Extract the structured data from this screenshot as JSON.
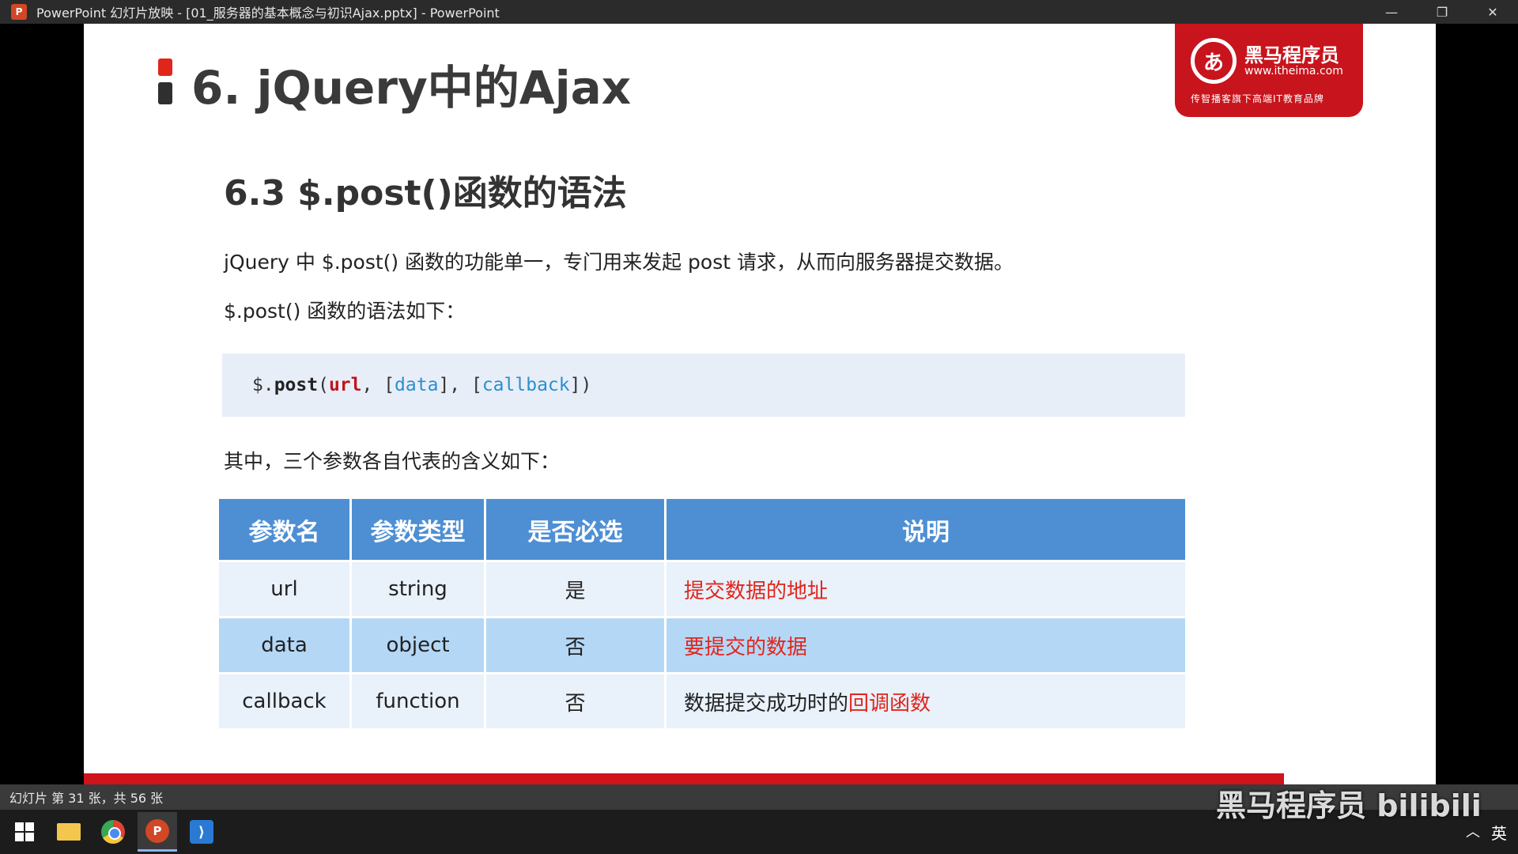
{
  "window": {
    "app_icon": "P",
    "title": "PowerPoint 幻灯片放映 - [01_服务器的基本概念与初识Ajax.pptx] - PowerPoint",
    "controls": {
      "minimize": "—",
      "restore": "❐",
      "close": "✕"
    }
  },
  "slide": {
    "title": "6. jQuery中的Ajax",
    "logo": {
      "mark": "あ",
      "name": "黑马程序员",
      "url": "www.itheima.com",
      "tagline": "传智播客旗下高端IT教育品牌"
    },
    "section_heading": "6.3 $.post()函数的语法",
    "paragraph1": "jQuery 中 $.post() 函数的功能单一，专门用来发起 post 请求，从而向服务器提交数据。",
    "paragraph2": "$.post() 函数的语法如下：",
    "code": {
      "prefix": "$.",
      "method": "post",
      "open": "(",
      "url": "url",
      "sep1": ", [",
      "data": "data",
      "sep2": "], [",
      "callback": "callback",
      "close": "])"
    },
    "paragraph3": "其中，三个参数各自代表的含义如下：",
    "table": {
      "headers": [
        "参数名",
        "参数类型",
        "是否必选",
        "说明"
      ],
      "rows": [
        {
          "name": "url",
          "type": "string",
          "required": "是",
          "desc_plain": "",
          "desc_red": "提交数据的地址"
        },
        {
          "name": "data",
          "type": "object",
          "required": "否",
          "desc_plain": "",
          "desc_red": "要提交的数据"
        },
        {
          "name": "callback",
          "type": "function",
          "required": "否",
          "desc_plain": "数据提交成功时的",
          "desc_red": "回调函数"
        }
      ]
    }
  },
  "statusbar": {
    "text": "幻灯片 第 31 张，共 56 张"
  },
  "taskbar": {
    "ppt_label": "P",
    "vscode_label": "⟩",
    "tray_chevron": "︿",
    "ime": "英"
  },
  "watermark": "黑马程序员 bilibili",
  "colors": {
    "accent_red": "#e1251b",
    "table_header": "#4e8fd4",
    "row_light": "#e9f1fb",
    "row_mid": "#b4d7f6",
    "code_bg": "#e8eef8"
  }
}
